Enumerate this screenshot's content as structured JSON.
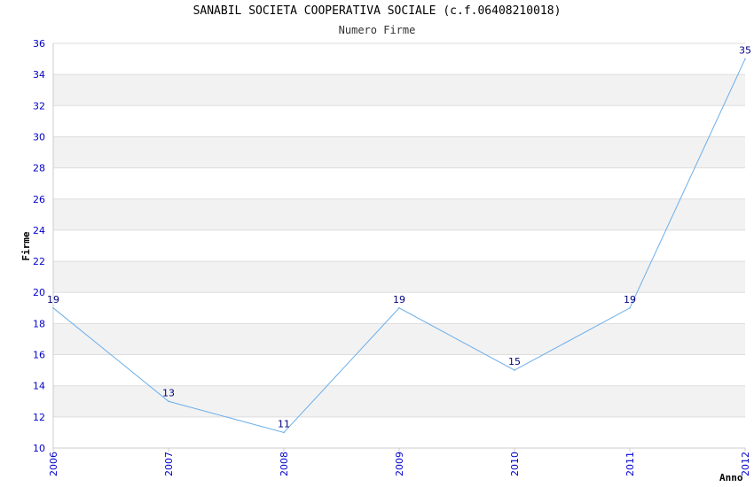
{
  "chart_data": {
    "type": "line",
    "title": "SANABIL SOCIETA COOPERATIVA SOCIALE (c.f.06408210018)",
    "subtitle": "Numero Firme",
    "xlabel": "Anno",
    "ylabel": "Firme",
    "x": [
      "2006",
      "2007",
      "2008",
      "2009",
      "2010",
      "2011",
      "2012"
    ],
    "series": [
      {
        "values": [
          19,
          13,
          11,
          19,
          15,
          19,
          35
        ]
      }
    ],
    "ylim": [
      10,
      36
    ],
    "yticks": [
      10,
      12,
      14,
      16,
      18,
      20,
      22,
      24,
      26,
      28,
      30,
      32,
      34,
      36
    ],
    "grid": true,
    "colors": {
      "line": "#6aaeea",
      "band": "#f2f2f2",
      "tick": "#0000cc",
      "label": "#000080"
    }
  }
}
